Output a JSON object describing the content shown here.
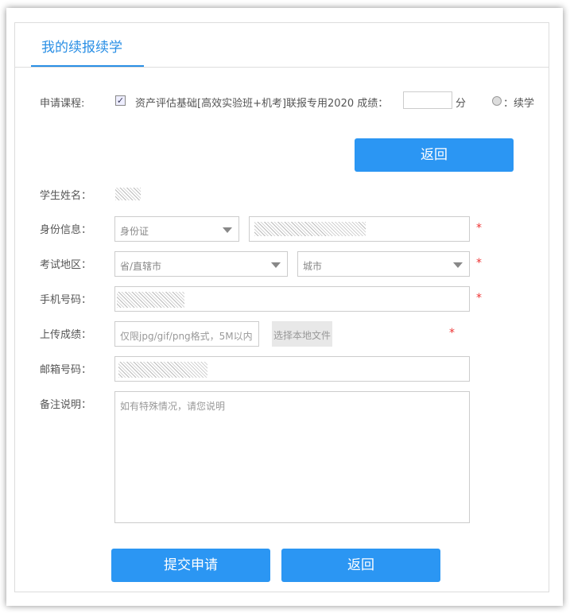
{
  "header": {
    "title": "我的续报续学"
  },
  "course": {
    "label": "申请课程:",
    "checked": true,
    "name": "资产评估基础[高效实验班+机考]联报专用2020 成绩：",
    "score_value": "",
    "score_unit": "分",
    "renew_label": "：续学"
  },
  "top_back_button": "返回",
  "form": {
    "name_label": "学生姓名：",
    "id_label": "身份信息：",
    "id_type": "身份证",
    "region_label": "考试地区：",
    "province": "省/直辖市",
    "city": "城市",
    "phone_label": "手机号码：",
    "upload_label": "上传成绩：",
    "upload_placeholder": "仅限jpg/gif/png格式，5M以内",
    "upload_button": "选择本地文件",
    "email_label": "邮箱号码：",
    "note_label": "备注说明：",
    "note_placeholder": "如有特殊情况，请您说明",
    "required_mark": "*"
  },
  "actions": {
    "submit": "提交申请",
    "back": "返回"
  }
}
